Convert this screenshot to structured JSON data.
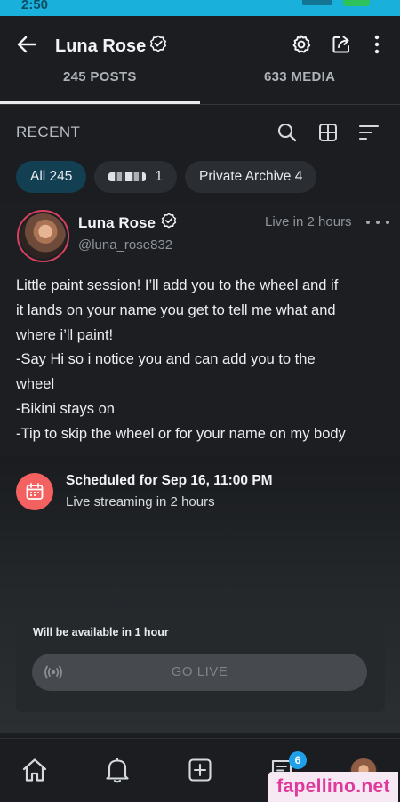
{
  "status_bar": {
    "time": "2:50"
  },
  "header": {
    "title": "Luna Rose",
    "icons": [
      "back-arrow-icon",
      "verified-badge-icon",
      "gear-icon",
      "share-icon",
      "more-vertical-icon"
    ]
  },
  "tabs": [
    {
      "label": "245 POSTS",
      "active": true
    },
    {
      "label": "633 MEDIA",
      "active": false
    }
  ],
  "section": {
    "title": "RECENT",
    "icons": [
      "search-icon",
      "grid-view-icon",
      "sort-icon"
    ]
  },
  "filters": [
    {
      "label": "All 245",
      "active": true
    },
    {
      "label": "1",
      "active": false
    },
    {
      "label": "Private Archive 4",
      "active": false
    }
  ],
  "post": {
    "author": "Luna Rose",
    "handle": "@luna_rose832",
    "time": "Live in 2 hours",
    "lines": [
      "Little paint session! I’ll add you to the wheel and if",
      "it lands on your name you get to tell me what and",
      "where i’ll paint!",
      "-Say Hi so i notice you and can add you to the",
      "wheel",
      "-Bikini stays on",
      "-Tip to skip the wheel or for your name on my body"
    ]
  },
  "schedule": {
    "title": "Scheduled for Sep 16, 11:00 PM",
    "subtitle": "Live streaming in 2 hours",
    "availability": "Will be available in 1 hour",
    "button_label": "GO LIVE"
  },
  "bottom_nav": {
    "items": [
      "home-icon",
      "bell-icon",
      "add-post-icon",
      "messages-icon",
      "profile-avatar"
    ],
    "messages_badge": "6"
  },
  "watermark": "fapellino.net",
  "colors": {
    "background": "#1b1d21",
    "accent": "#1ea0ea",
    "active_chip": "#133f52",
    "calendar_red": "#f46161",
    "status_bar": "#19b0dc"
  }
}
